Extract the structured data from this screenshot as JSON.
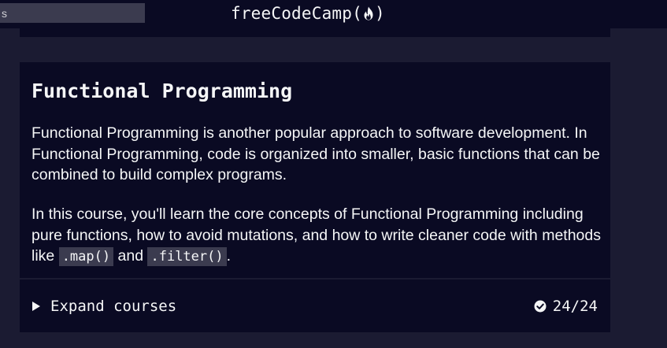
{
  "nav": {
    "search_placeholder": "s",
    "brand_name": "freeCodeCamp",
    "brand_open": "(",
    "brand_close": ")",
    "brand_icon": "flame-icon"
  },
  "card": {
    "title": "Functional Programming",
    "paragraphs": [
      "Functional Programming is another popular approach to software development. In Functional Programming, code is organized into smaller, basic functions that can be combined to build complex programs.",
      {
        "before": "In this course, you'll learn the core concepts of Functional Programming including pure functions, how to avoid mutations, and how to write cleaner code with methods like ",
        "code1": ".map()",
        "middle": " and ",
        "code2": ".filter()",
        "after": "."
      }
    ],
    "expand_label": "Expand courses",
    "expand_icon": "triangle-right-icon",
    "progress_icon": "check-circle-icon",
    "progress_text": "24/24"
  },
  "colors": {
    "page_bg": "#1b1b32",
    "card_bg": "#0a0a23",
    "text": "#f5f6f7",
    "code_bg": "#3b3b4f"
  }
}
